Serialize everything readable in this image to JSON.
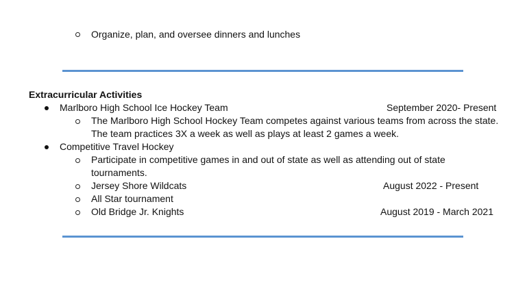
{
  "top_item": {
    "text": "Organize, plan, and oversee dinners and lunches"
  },
  "section": {
    "heading": "Extracurricular Activities",
    "activities": [
      {
        "title": "Marlboro High School Ice Hockey Team",
        "date": "September 2020- Present",
        "subitems": [
          {
            "lines": [
              "The Marlboro High School Hockey Team competes against various teams from across the state.",
              "The team practices 3X a week as well as plays at least 2 games a week."
            ]
          }
        ]
      },
      {
        "title": "Competitive Travel Hockey",
        "subitems": [
          {
            "lines": [
              "Participate in competitive games in and out of state as well as attending out of state",
              "tournaments."
            ]
          },
          {
            "text": "Jersey Shore Wildcats",
            "date": "August 2022 - Present"
          },
          {
            "text": "All Star tournament"
          },
          {
            "text": "Old Bridge Jr. Knights",
            "date": "August 2019 - March 2021"
          }
        ]
      }
    ]
  },
  "colors": {
    "rule": "#5b93d1",
    "text": "#111111"
  }
}
